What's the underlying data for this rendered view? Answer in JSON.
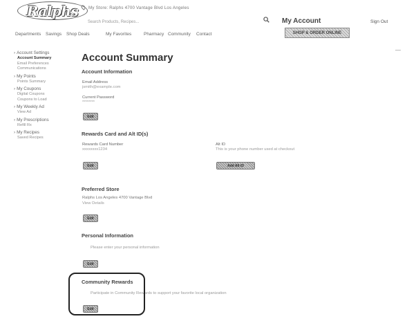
{
  "header": {
    "logo": "Ralphs",
    "store_line": "My Store: Ralphs 4700 Vantage Blvd Los Angeles",
    "search_placeholder": "Search Products, Recipes...",
    "my_account": "My Account",
    "sign_out": "Sign Out",
    "order_button": "SHOP & ORDER ONLINE"
  },
  "topnav": [
    "Departments",
    "Savings",
    "Shop Deals",
    "My Favorites",
    "Pharmacy",
    "Community",
    "Contact"
  ],
  "sidebar": [
    {
      "label": "Account Settings",
      "items": [
        {
          "label": "Account Summary",
          "active": true
        },
        {
          "label": "Email Preferences",
          "active": false
        },
        {
          "label": "Communications",
          "active": false
        }
      ]
    },
    {
      "label": "My Points",
      "items": [
        {
          "label": "Points Summary",
          "active": false
        }
      ]
    },
    {
      "label": "My Coupons",
      "items": [
        {
          "label": "Digital Coupons",
          "active": false
        },
        {
          "label": "Coupons to Load",
          "active": false
        }
      ]
    },
    {
      "label": "My Weekly Ad",
      "items": [
        {
          "label": "View Ad",
          "active": false
        }
      ]
    },
    {
      "label": "My Prescriptions",
      "items": [
        {
          "label": "Refill Rx",
          "active": false
        }
      ]
    },
    {
      "label": "My Recipes",
      "items": [
        {
          "label": "Saved Recipes",
          "active": false
        }
      ]
    }
  ],
  "main": {
    "title": "Account Summary",
    "account_info": {
      "heading": "Account Information",
      "email_label": "Email Address",
      "email_value": "jsmith@example.com",
      "password_label": "Current Password",
      "password_value": "********",
      "edit": "Edit"
    },
    "rewards": {
      "heading": "Rewards Card and Alt ID(s)",
      "card_label": "Rewards Card Number",
      "card_value": "xxxxxxxx1234",
      "alt_label": "Alt ID",
      "alt_value": "This is your phone number used at checkout",
      "edit": "Edit",
      "add_alt": "Add Alt ID"
    },
    "preferred_store": {
      "heading": "Preferred Store",
      "address": "Ralphs Los Angeles 4700 Vantage Blvd",
      "link": "View Details",
      "edit": "Edit"
    },
    "personal": {
      "heading": "Personal Information",
      "note": "Please enter your personal information",
      "edit": "Edit"
    },
    "community": {
      "heading": "Community Rewards",
      "note": "Participate in Community Rewards to support your favorite local organization",
      "edit": "Edit"
    }
  }
}
